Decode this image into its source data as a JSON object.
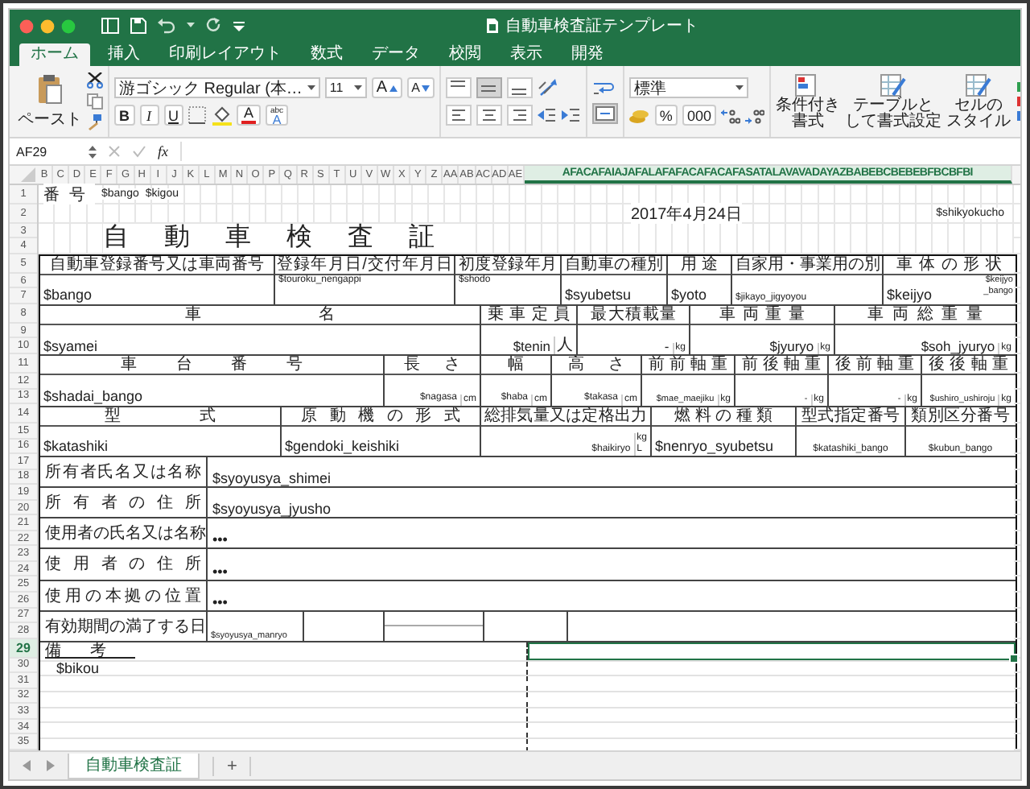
{
  "window": {
    "title": "自動車検査証テンプレート"
  },
  "ribbon_tabs": [
    {
      "label": "ホーム",
      "selected": true
    },
    {
      "label": "挿入",
      "selected": false
    },
    {
      "label": "印刷レイアウト",
      "selected": false
    },
    {
      "label": "数式",
      "selected": false
    },
    {
      "label": "データ",
      "selected": false
    },
    {
      "label": "校閲",
      "selected": false
    },
    {
      "label": "表示",
      "selected": false
    },
    {
      "label": "開発",
      "selected": false
    }
  ],
  "ribbon": {
    "paste_label": "ペースト",
    "font_name": "游ゴシック Regular (本…",
    "font_size": "11",
    "grow_font": "A",
    "shrink_font": "A",
    "bold": "B",
    "italic": "I",
    "underline": "U",
    "font_color": "A",
    "phonetic_top": "abc",
    "phonetic_bottom": "A",
    "align_buttons": [
      {
        "selected": false
      },
      {
        "selected": true
      },
      {
        "selected": false
      },
      {
        "selected": false
      },
      {
        "selected": false
      },
      {
        "selected": false
      }
    ],
    "merge": {
      "selected": true
    },
    "number_format": "標準",
    "percent": "%",
    "comma": "000",
    "styles": [
      {
        "lines": [
          "条件付き",
          "書式"
        ]
      },
      {
        "lines": [
          "テーブルと",
          "して書式設定"
        ]
      },
      {
        "lines": [
          "セルの",
          "スタイル"
        ]
      }
    ]
  },
  "formula_bar": {
    "name_box": "AF29",
    "fx": "fx"
  },
  "column_headers": [
    {
      "label": "B",
      "selected": false
    },
    {
      "label": "C",
      "selected": false
    },
    {
      "label": "D",
      "selected": false
    },
    {
      "label": "E",
      "selected": false
    },
    {
      "label": "F",
      "selected": false
    },
    {
      "label": "G",
      "selected": false
    },
    {
      "label": "H",
      "selected": false
    },
    {
      "label": "I",
      "selected": false
    },
    {
      "label": "J",
      "selected": false
    },
    {
      "label": "K",
      "selected": false
    },
    {
      "label": "L",
      "selected": false
    },
    {
      "label": "M",
      "selected": false
    },
    {
      "label": "N",
      "selected": false
    },
    {
      "label": "O",
      "selected": false
    },
    {
      "label": "P",
      "selected": false
    },
    {
      "label": "Q",
      "selected": false
    },
    {
      "label": "R",
      "selected": false
    },
    {
      "label": "S",
      "selected": false
    },
    {
      "label": "T",
      "selected": false
    },
    {
      "label": "U",
      "selected": false
    },
    {
      "label": "V",
      "selected": false
    },
    {
      "label": "W",
      "selected": false
    },
    {
      "label": "X",
      "selected": false
    },
    {
      "label": "Y",
      "selected": false
    },
    {
      "label": "Z",
      "selected": false
    },
    {
      "label": "AA",
      "selected": false
    },
    {
      "label": "AB",
      "selected": false
    },
    {
      "label": "AC",
      "selected": false
    },
    {
      "label": "AD",
      "selected": false
    },
    {
      "label": "AE",
      "selected": false
    },
    {
      "label": "AFACAFAIAJAFALAFAFACAFACAFASATALAVAVADAYAZBABEBCBEBEBFBCBFBI",
      "selected": true
    }
  ],
  "row_headers": [
    {
      "label": "1",
      "selected": false
    },
    {
      "label": "2",
      "selected": false
    },
    {
      "label": "3",
      "selected": false
    },
    {
      "label": "4",
      "selected": false
    },
    {
      "label": "5",
      "selected": false
    },
    {
      "label": "6",
      "selected": false
    },
    {
      "label": "7",
      "selected": false
    },
    {
      "label": "8",
      "selected": false
    },
    {
      "label": "9",
      "selected": false
    },
    {
      "label": "10",
      "selected": false
    },
    {
      "label": "11",
      "selected": false
    },
    {
      "label": "12",
      "selected": false
    },
    {
      "label": "13",
      "selected": false
    },
    {
      "label": "14",
      "selected": false
    },
    {
      "label": "15",
      "selected": false
    },
    {
      "label": "16",
      "selected": false
    },
    {
      "label": "17",
      "selected": false
    },
    {
      "label": "18",
      "selected": false
    },
    {
      "label": "19",
      "selected": false
    },
    {
      "label": "20",
      "selected": false
    },
    {
      "label": "21",
      "selected": false
    },
    {
      "label": "22",
      "selected": false
    },
    {
      "label": "23",
      "selected": false
    },
    {
      "label": "24",
      "selected": false
    },
    {
      "label": "25",
      "selected": false
    },
    {
      "label": "26",
      "selected": false
    },
    {
      "label": "27",
      "selected": false
    },
    {
      "label": "28",
      "selected": false
    },
    {
      "label": "29",
      "selected": true
    },
    {
      "label": "30",
      "selected": false
    },
    {
      "label": "31",
      "selected": false
    },
    {
      "label": "32",
      "selected": false
    },
    {
      "label": "33",
      "selected": false
    },
    {
      "label": "34",
      "selected": false
    },
    {
      "label": "35",
      "selected": false
    }
  ],
  "sheet_header": {
    "number_label": "番号",
    "bango": "$bango",
    "kigou": "$kigou",
    "date": "2017年4月24日",
    "shikyokucho": "$shikyokucho"
  },
  "form_title": "自動車検査証",
  "bands": [
    {
      "cells": [
        {
          "label": "自動車登録番号又は車両番号",
          "value": "$bango"
        },
        {
          "label": "登録年月日/交付年月日",
          "value": "$touroku_nengappi"
        },
        {
          "label": "初度登録年月",
          "value": "$shodo"
        },
        {
          "label": "自動車の種別",
          "value": "$syubetsu"
        },
        {
          "label": "用途",
          "value": "$yoto"
        },
        {
          "label": "自家用・事業用の別",
          "value": "$jikayo_jigyoyou"
        },
        {
          "label": "車体の形状",
          "value": "$keijyo",
          "note_lines": [
            "$keijyo",
            "_bango"
          ]
        }
      ]
    },
    {
      "cells": [
        {
          "label": "車名",
          "value": "$syamei"
        },
        {
          "label": "乗車定員",
          "value": "$tenin",
          "unit": "人"
        },
        {
          "label": "最大積載量",
          "value": "-",
          "unit": "kg"
        },
        {
          "label": "車両重量",
          "value": "$jyuryo",
          "unit": "kg"
        },
        {
          "label": "車両総重量",
          "value": "$soh_jyuryo",
          "unit": "kg"
        }
      ]
    },
    {
      "cells": [
        {
          "label": "車台番号",
          "value": "$shadai_bango"
        },
        {
          "label": "長さ",
          "value": "$nagasa",
          "unit": "cm"
        },
        {
          "label": "幅",
          "value": "$haba",
          "unit": "cm"
        },
        {
          "label": "高さ",
          "value": "$takasa",
          "unit": "cm"
        },
        {
          "label": "前前軸重",
          "value": "$mae_maejiku",
          "unit": "kg"
        },
        {
          "label": "前後軸重",
          "value": "-",
          "unit": "kg"
        },
        {
          "label": "後前軸重",
          "value": "-",
          "unit": "kg"
        },
        {
          "label": "後後軸重",
          "value": "$ushiro_ushiroju",
          "unit": "kg"
        }
      ]
    },
    {
      "cells": [
        {
          "label": "型式",
          "value": "$katashiki"
        },
        {
          "label": "原動機の形式",
          "value": "$gendoki_keishiki"
        },
        {
          "label": "総排気量又は定格出力",
          "value": "$haikiryo",
          "units": [
            "kg",
            "L"
          ]
        },
        {
          "label": "燃料の種類",
          "value": "$nenryo_syubetsu"
        },
        {
          "label": "型式指定番号",
          "value": "$katashiki_bango"
        },
        {
          "label": "類別区分番号",
          "value": "$kubun_bango"
        }
      ]
    }
  ],
  "owner_rows": [
    {
      "label": "所有者氏名又は名称",
      "value": "$syoyusya_shimei"
    },
    {
      "label": "所有者の住所",
      "value": "$syoyusya_jyusho"
    },
    {
      "label": "使用者の氏名又は名称",
      "value": "•••"
    },
    {
      "label": "使用者の住所",
      "value": "•••"
    },
    {
      "label": "使用の本拠の位置",
      "value": "•••"
    }
  ],
  "expiry": {
    "label": "有効期間の満了する日",
    "value": "$syoyusya_manryo"
  },
  "remarks": {
    "label": "備考",
    "value": "$bikou"
  },
  "sheet_tabs": [
    {
      "label": "自動車検査証",
      "selected": true
    }
  ],
  "add_sheet": "+"
}
